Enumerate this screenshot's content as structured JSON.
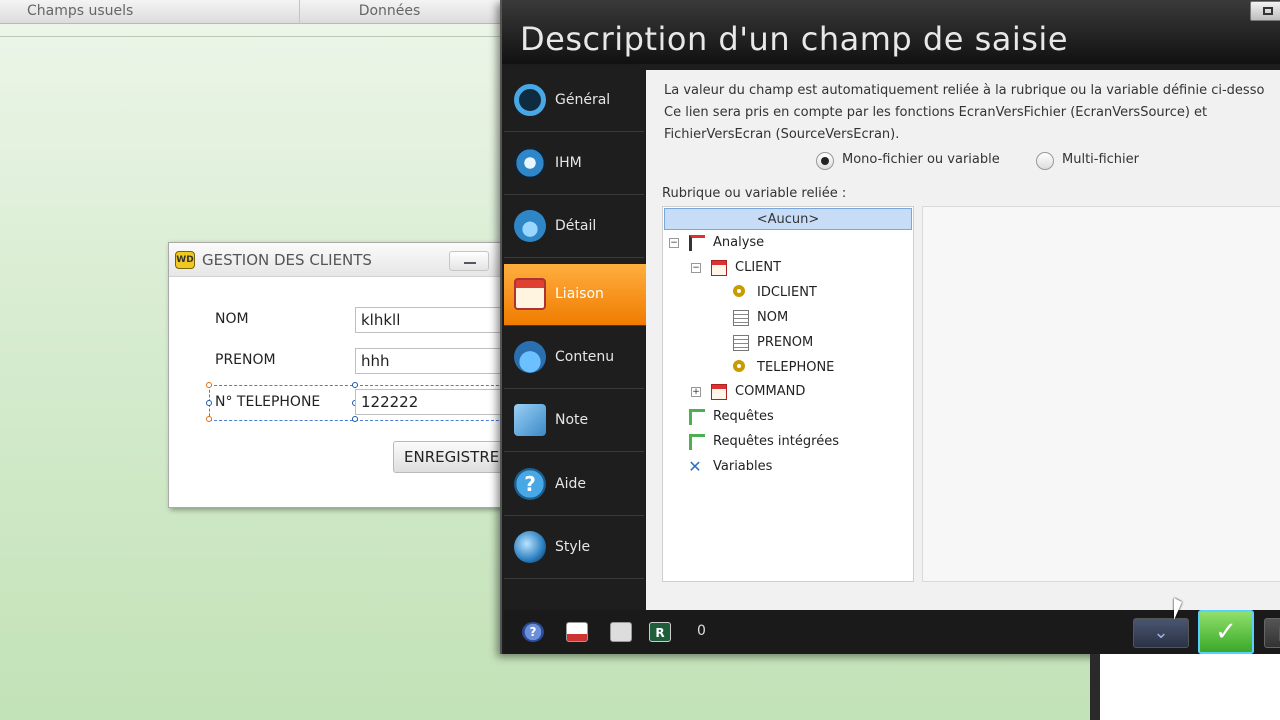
{
  "editor": {
    "top_tabs": [
      "Champs usuels",
      "Données"
    ]
  },
  "client_window": {
    "title": "GESTION DES CLIENTS",
    "fields": [
      {
        "label": "NOM",
        "value": "klhkll"
      },
      {
        "label": "PRENOM",
        "value": "hhh"
      },
      {
        "label": "N° TELEPHONE",
        "value": "122222"
      }
    ],
    "button": "ENREGISTRE"
  },
  "dialog": {
    "title": "Description d'un champ de saisie",
    "nav": [
      "Général",
      "IHM",
      "Détail",
      "Liaison",
      "Contenu",
      "Note",
      "Aide",
      "Style"
    ],
    "active_nav": "Liaison",
    "description_lines": [
      "La valeur du champ est automatiquement reliée à la rubrique ou la variable définie ci-desso",
      "Ce lien sera pris en compte par les fonctions EcranVersFichier (EcranVersSource) et",
      "FichierVersEcran (SourceVersEcran)."
    ],
    "radio_mono": "Mono-fichier ou variable",
    "radio_multi": "Multi-fichier",
    "rubrique_label": "Rubrique ou variable reliée :",
    "tree": {
      "none": "<Aucun>",
      "analyse": "Analyse",
      "client": "CLIENT",
      "client_fields": [
        "IDCLIENT",
        "NOM",
        "PRENOM",
        "TELEPHONE"
      ],
      "command": "COMMAND",
      "requetes": "Requêtes",
      "requetes_integrees": "Requêtes intégrées",
      "variables": "Variables"
    },
    "bottom_count": "0"
  }
}
